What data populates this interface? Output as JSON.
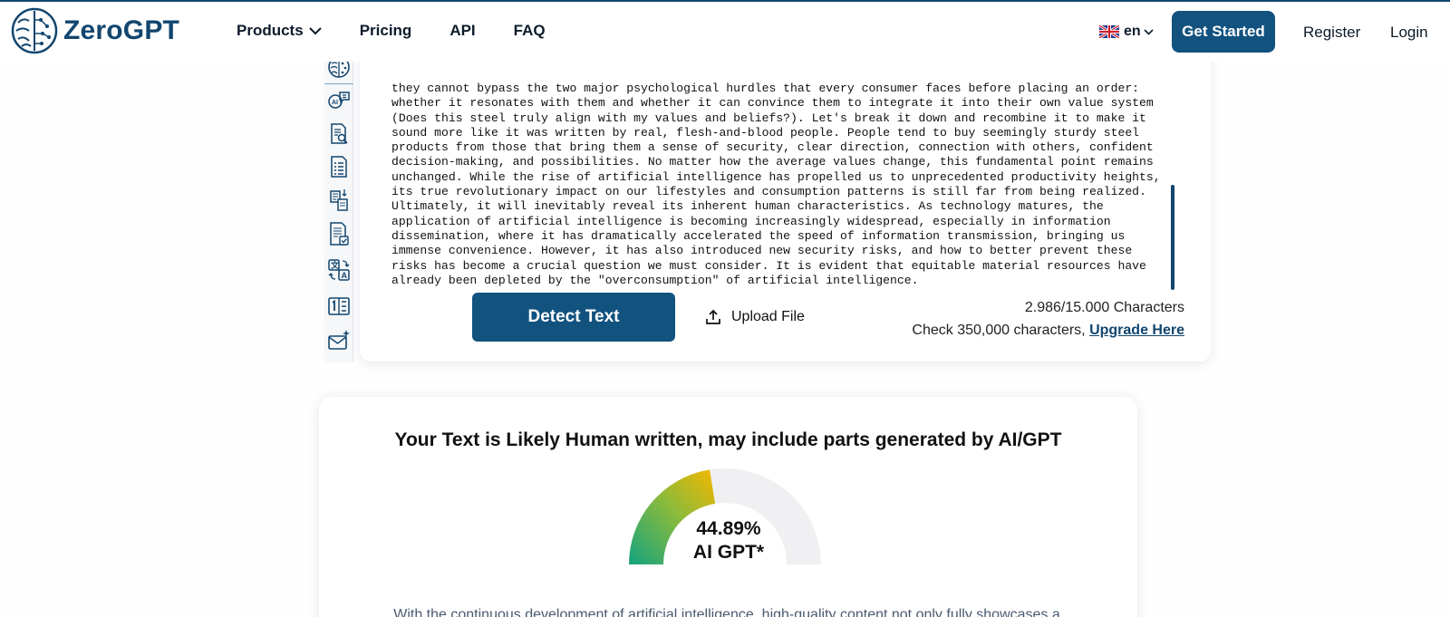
{
  "brand": {
    "name": "ZeroGPT",
    "colors": {
      "primary": "#12527f",
      "accent_dark": "#12466f",
      "gauge_green": "#14a37f",
      "gauge_yellow": "#f5b700",
      "gauge_track": "#f0f0f2"
    }
  },
  "nav": {
    "items": [
      {
        "label": "Products",
        "has_dropdown": true
      },
      {
        "label": "Pricing"
      },
      {
        "label": "API"
      },
      {
        "label": "FAQ"
      }
    ],
    "language": {
      "flag_icon": "uk-flag-icon",
      "code": "en"
    },
    "get_started": "Get Started",
    "register": "Register",
    "login": "Login"
  },
  "sidebar": {
    "icons": [
      "zerogpt-brain-icon",
      "ai-chat-icon",
      "document-search-icon",
      "document-list-icon",
      "summarizer-icon",
      "document-check-icon",
      "translate-icon",
      "word-counter-icon",
      "email-sparkle-icon"
    ]
  },
  "editor": {
    "text": "they cannot bypass the two major psychological hurdles that every consumer faces before placing an order: whether it resonates with them and whether it can convince them to integrate it into their own value system (Does this steel truly align with my values and beliefs?). Let's break it down and recombine it to make it sound more like it was written by real, flesh-and-blood people. People tend to buy seemingly sturdy steel products from those that bring them a sense of security, clear direction, connection with others, confident decision-making, and possibilities. No matter how the average values change, this fundamental point remains unchanged. While the rise of artificial intelligence has propelled us to unprecedented productivity heights, its true revolutionary impact on our lifestyles and consumption patterns is still far from being realized. Ultimately, it will inevitably reveal its inherent human characteristics. As technology matures, the application of artificial intelligence is becoming increasingly widespread, especially in information dissemination, where it has dramatically accelerated the speed of information transmission, bringing us immense convenience. However, it has also introduced new security risks, and how to better prevent these risks has become a crucial question we must consider. It is evident that equitable material resources have already been depleted by the \"overconsumption\" of artificial intelligence.",
    "detect_button": "Detect Text",
    "upload_label": "Upload File",
    "char_count": "2.986/15.000 Characters",
    "check_prefix": "Check 350,000 characters,",
    "upgrade_link": "Upgrade Here"
  },
  "result": {
    "title": "Your Text is Likely Human written, may include parts generated by AI/GPT",
    "percentage_text": "44.89%",
    "percentage_value": 44.89,
    "label": "AI GPT*",
    "description": "With the continuous development of artificial intelligence, high-quality content not only fully showcases a"
  }
}
